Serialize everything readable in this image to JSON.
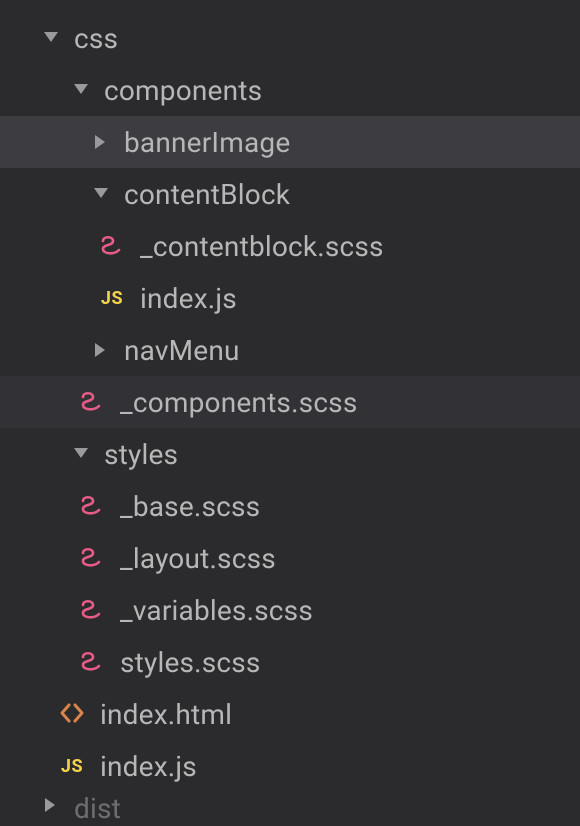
{
  "tree": {
    "css": {
      "label": "css",
      "components": {
        "label": "components",
        "bannerImage": "bannerImage",
        "contentBlock": {
          "label": "contentBlock",
          "scss": "_contentblock.scss",
          "js": "index.js"
        },
        "navMenu": "navMenu",
        "componentsScss": "_components.scss"
      },
      "styles": {
        "label": "styles",
        "base": "_base.scss",
        "layout": "_layout.scss",
        "variables": "_variables.scss",
        "styles": "styles.scss"
      }
    },
    "indexHtml": "index.html",
    "indexJs": "index.js",
    "dist": "dist"
  },
  "icons": {
    "chev": "chevron",
    "sass": "sass",
    "js": "JS",
    "html": "html"
  }
}
